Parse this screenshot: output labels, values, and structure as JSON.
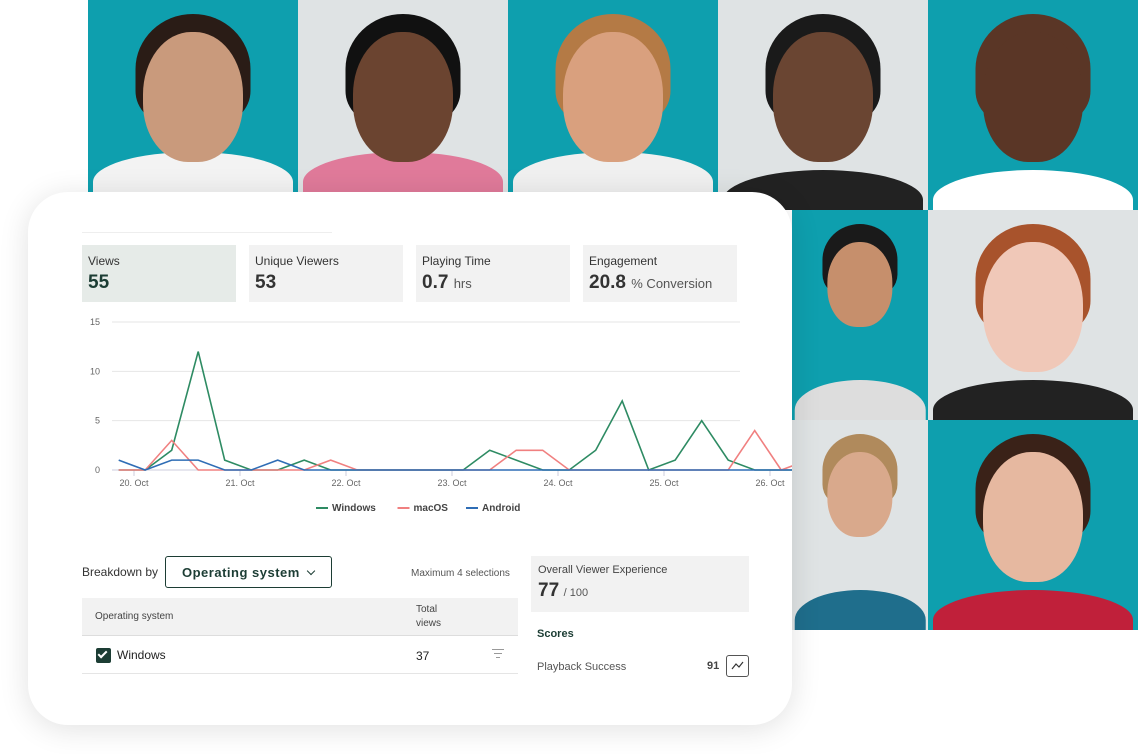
{
  "kpis": [
    {
      "label": "Views",
      "value": "55",
      "unit": ""
    },
    {
      "label": "Unique Viewers",
      "value": "53",
      "unit": ""
    },
    {
      "label": "Playing Time",
      "value": "0.7",
      "unit": "hrs"
    },
    {
      "label": "Engagement",
      "value": "20.8",
      "unit": "% Conversion"
    }
  ],
  "chart_data": {
    "type": "line",
    "x_ticks": [
      "20. Oct",
      "21. Oct",
      "22. Oct",
      "23. Oct",
      "24. Oct",
      "25. Oct",
      "26. Oct"
    ],
    "y_ticks": [
      0,
      5,
      10,
      15
    ],
    "ylim": [
      0,
      15
    ],
    "grid": true,
    "legend": "bottom",
    "series": [
      {
        "name": "Windows",
        "color": "#2e8b63",
        "values": [
          0,
          0,
          2,
          12,
          1,
          0,
          0,
          1,
          0,
          0,
          0,
          0,
          0,
          0,
          2,
          1,
          0,
          0,
          2,
          7,
          0,
          1,
          5,
          1,
          0,
          0,
          0,
          0
        ]
      },
      {
        "name": "macOS",
        "color": "#f08080",
        "values": [
          0,
          0,
          3,
          0,
          0,
          0,
          0,
          0,
          1,
          0,
          0,
          0,
          0,
          0,
          0,
          2,
          2,
          0,
          0,
          0,
          0,
          0,
          0,
          0,
          4,
          0,
          1,
          1
        ]
      },
      {
        "name": "Android",
        "color": "#2f6db5",
        "values": [
          1,
          0,
          1,
          1,
          0,
          0,
          1,
          0,
          0,
          0,
          0,
          0,
          0,
          0,
          0,
          0,
          0,
          0,
          0,
          0,
          0,
          0,
          0,
          0,
          0,
          0,
          0,
          0
        ]
      }
    ]
  },
  "breakdown": {
    "label": "Breakdown by",
    "selected": "Operating system",
    "max_note": "Maximum 4 selections"
  },
  "table": {
    "headers": [
      "Operating system",
      "Total views"
    ],
    "rows": [
      {
        "name": "Windows",
        "views": "37",
        "checked": true
      }
    ]
  },
  "experience": {
    "title": "Overall Viewer Experience",
    "score": "77",
    "max": "/ 100",
    "scores_title": "Scores",
    "scores": [
      {
        "label": "Playback Success",
        "value": "91"
      }
    ]
  },
  "colors": {
    "teal": "#0e9fae",
    "grey": "#dfe3e4",
    "accent": "#1c3d34"
  }
}
